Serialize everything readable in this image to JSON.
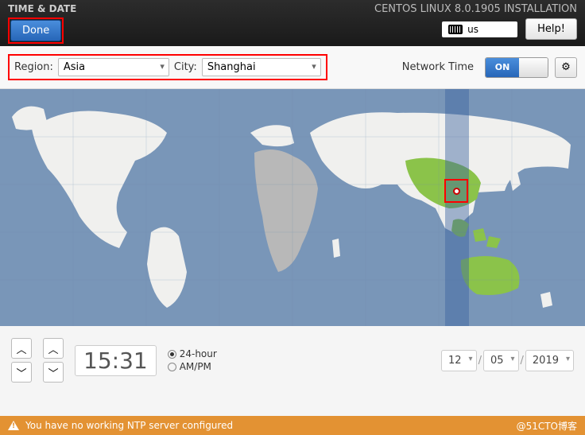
{
  "header": {
    "page_title": "TIME & DATE",
    "done_label": "Done",
    "install_title": "CENTOS LINUX 8.0.1905 INSTALLATION",
    "keyboard_layout": "us",
    "help_label": "Help!"
  },
  "controls": {
    "region_label": "Region:",
    "region_value": "Asia",
    "city_label": "City:",
    "city_value": "Shanghai",
    "network_time_label": "Network Time",
    "toggle_on": "ON"
  },
  "time": {
    "hour": "15",
    "separator": ":",
    "minute": "31",
    "fmt_24": "24-hour",
    "fmt_12": "AM/PM",
    "date_month": "12",
    "date_day": "05",
    "date_year": "2019",
    "date_sep": "/"
  },
  "warning": {
    "text": "You have no working NTP server configured",
    "watermark": "@51CTO博客"
  }
}
